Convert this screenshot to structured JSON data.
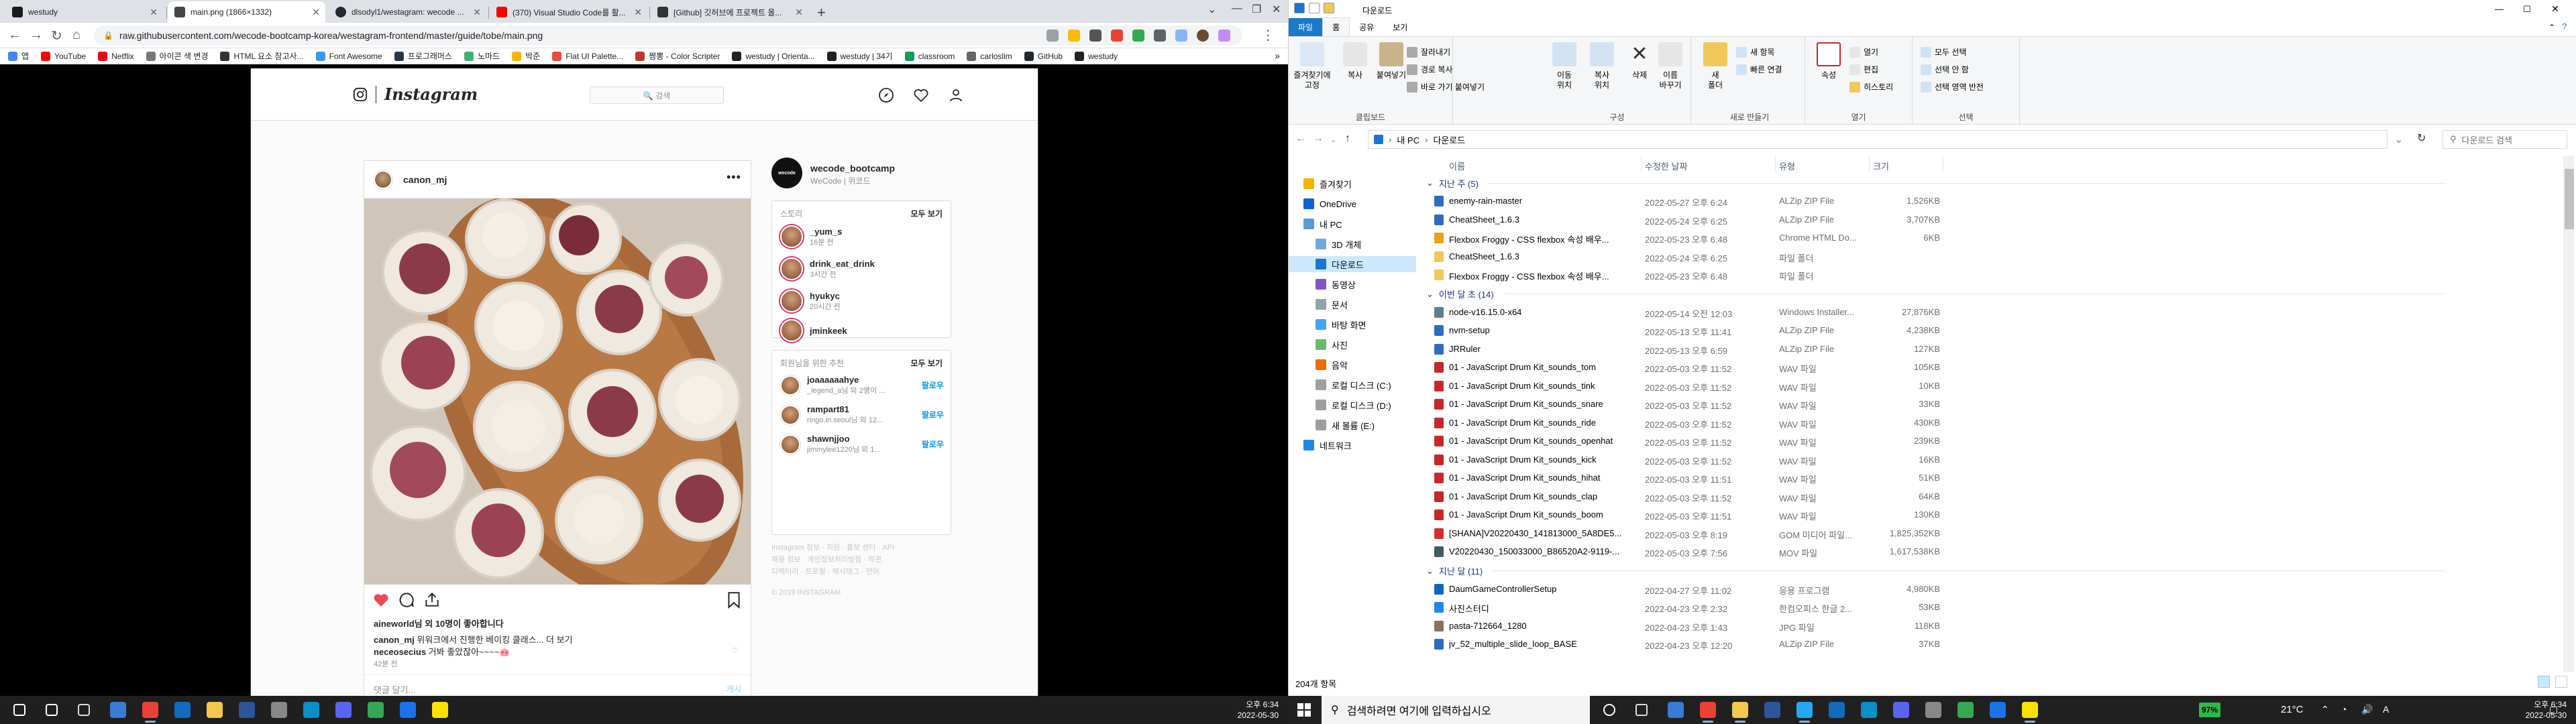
{
  "chrome": {
    "tabs": [
      {
        "title": "westudy",
        "color": "#1a1a1a"
      },
      {
        "title": "main.png (1866×1332)",
        "color": "#444444"
      },
      {
        "title": "dlsodyl1/westagram: wecode ...",
        "color": "#24292e"
      },
      {
        "title": "(370) Visual Studio Code를 활...",
        "color": "#ff0000"
      },
      {
        "title": "[Github] 깃허브에 프로젝트 올...",
        "color": "#333333"
      }
    ],
    "active_tab": 1,
    "url": "raw.githubusercontent.com/wecode-bootcamp-korea/westagram-frontend/master/guide/tobe/main.png",
    "bookmarks": [
      {
        "label": "앱",
        "color": "#4285f4"
      },
      {
        "label": "YouTube",
        "color": "#ff0000"
      },
      {
        "label": "Netflix",
        "color": "#e50914"
      },
      {
        "label": "아이콘 색 변경",
        "color": "#777777"
      },
      {
        "label": "HTML 요소 참고사...",
        "color": "#333333"
      },
      {
        "label": "Font Awesome",
        "color": "#339af0"
      },
      {
        "label": "프로그래머스",
        "color": "#263747"
      },
      {
        "label": "노마드",
        "color": "#3cb371"
      },
      {
        "label": "박준",
        "color": "#ffb400"
      },
      {
        "label": "Flat UI Palette...",
        "color": "#e74c3c"
      },
      {
        "label": "짬뽕 - Color Scripter",
        "color": "#c0392b"
      },
      {
        "label": "westudy | Orienta...",
        "color": "#222222"
      },
      {
        "label": "westudy | 34기",
        "color": "#222222"
      },
      {
        "label": "classroom",
        "color": "#0f9d58"
      },
      {
        "label": "carloslim",
        "color": "#666666"
      },
      {
        "label": "GitHub",
        "color": "#24292e"
      },
      {
        "label": "westudy",
        "color": "#222222"
      }
    ],
    "bookmarks_more": "»"
  },
  "instagram": {
    "logo_word": "Instagram",
    "search_placeholder": "🔍 검색",
    "post": {
      "username": "canon_mj",
      "more": "•••",
      "likes": "aineworld님 외 10명이 좋아합니다",
      "caption_user": "canon_mj",
      "caption_text": "위워크에서 진행한 베이킹 클래스... 더 보기",
      "comment_user": "neceosecius",
      "comment_text": "거봐 좋았잖아~~~~🐽",
      "time_ago": "42분 전",
      "comment_placeholder": "댓글 달기...",
      "comment_post": "게시"
    },
    "side_profile": {
      "name": "wecode_bootcamp",
      "sub": "WeCode | 위코드",
      "avatar_text": "wecode"
    },
    "stories": {
      "header": "스토리",
      "see_all": "모두 보기",
      "items": [
        {
          "name": "_yum_s",
          "sub": "16분 전"
        },
        {
          "name": "drink_eat_drink",
          "sub": "3시간 전"
        },
        {
          "name": "hyukyc",
          "sub": "20시간 전"
        },
        {
          "name": "jminkeek",
          "sub": ""
        }
      ]
    },
    "suggestions": {
      "header": "회원님을 위한 추천",
      "see_all": "모두 보기",
      "items": [
        {
          "name": "joaaaaaahye",
          "sub": "_legend_a님 외 2명이 ...",
          "action": "팔로우"
        },
        {
          "name": "rampart81",
          "sub": "ringo.in.seoul님 외 12...",
          "action": "팔로우"
        },
        {
          "name": "shawnjjoo",
          "sub": "jimmylee1220님 외 1...",
          "action": "팔로우"
        }
      ]
    },
    "footer_lines": [
      "Instagram 정보 · 지원 · 홍보 센터 · API ·",
      "채용 정보 · 개인정보처리방침 · 약관 ·",
      "디렉터리 · 프로필 · 해시태그 · 언어"
    ],
    "copyright": "© 2019 INSTAGRAM"
  },
  "explorer": {
    "title": "다운로드",
    "ribbon_tabs": [
      "파일",
      "홈",
      "공유",
      "보기"
    ],
    "active_ribbon_tab": 1,
    "groups": [
      {
        "name": "클립보드"
      },
      {
        "name": "구성"
      },
      {
        "name": "새로 만들기"
      },
      {
        "name": "열기"
      },
      {
        "name": "선택"
      }
    ],
    "ribbon": {
      "pin": "즐겨찾기에\n고정",
      "copy": "복사",
      "paste": "붙여넣기",
      "cut": "잘라내기",
      "copy_path": "경로 복사",
      "paste_shortcut": "바로 가기 붙여넣기",
      "move_to": "이동\n위치",
      "copy_to": "복사\n위치",
      "delete": "삭제",
      "rename": "이름\n바꾸기",
      "new_folder": "새\n폴더",
      "new_item": "새 항목",
      "easy_access": "빠른 연결",
      "properties": "속성",
      "open": "열기",
      "edit": "편집",
      "history": "히스토리",
      "select_all": "모두 선택",
      "select_none": "선택 안 함",
      "invert": "선택 영역 반전"
    },
    "breadcrumb": [
      "내 PC",
      "다운로드"
    ],
    "search_placeholder": "다운로드 검색",
    "nav": [
      {
        "label": "즐겨찾기",
        "color": "#f4b400",
        "indent": 0
      },
      {
        "label": "OneDrive",
        "color": "#0a64d6",
        "indent": 0
      },
      {
        "label": "내 PC",
        "color": "#5b9bd5",
        "indent": 0
      },
      {
        "label": "3D 개체",
        "color": "#6fa8dc",
        "indent": 1
      },
      {
        "label": "다운로드",
        "color": "#1976d2",
        "indent": 1,
        "selected": true
      },
      {
        "label": "동영상",
        "color": "#7e57c2",
        "indent": 1
      },
      {
        "label": "문서",
        "color": "#90a4ae",
        "indent": 1
      },
      {
        "label": "바탕 화면",
        "color": "#42a5f5",
        "indent": 1
      },
      {
        "label": "사진",
        "color": "#66bb6a",
        "indent": 1
      },
      {
        "label": "음악",
        "color": "#ef6c00",
        "indent": 1
      },
      {
        "label": "로컬 디스크 (C:)",
        "color": "#9e9e9e",
        "indent": 1
      },
      {
        "label": "로컬 디스크 (D:)",
        "color": "#9e9e9e",
        "indent": 1
      },
      {
        "label": "새 볼륨 (E:)",
        "color": "#9e9e9e",
        "indent": 1
      },
      {
        "label": "네트워크",
        "color": "#1e88e5",
        "indent": 0
      }
    ],
    "columns": [
      "이름",
      "수정한 날짜",
      "유형",
      "크기"
    ],
    "groups_list": [
      {
        "title": "지난 주 (5)",
        "files": [
          {
            "name": "enemy-rain-master",
            "date": "2022-05-27 오후 6:24",
            "type": "ALZip ZIP File",
            "size": "1,526KB",
            "color": "#2d6cc0"
          },
          {
            "name": "CheatSheet_1.6.3",
            "date": "2022-05-24 오후 6:25",
            "type": "ALZip ZIP File",
            "size": "3,707KB",
            "color": "#2d6cc0"
          },
          {
            "name": "Flexbox Froggy - CSS flexbox 속성 배우...",
            "date": "2022-05-23 오후 6:48",
            "type": "Chrome HTML Do...",
            "size": "6KB",
            "color": "#e8a317"
          },
          {
            "name": "CheatSheet_1.6.3",
            "date": "2022-05-24 오후 6:25",
            "type": "파일 폴더",
            "size": "",
            "color": "#f0c85a"
          },
          {
            "name": "Flexbox Froggy - CSS flexbox 속성 배우...",
            "date": "2022-05-23 오후 6:48",
            "type": "파일 폴더",
            "size": "",
            "color": "#f0c85a"
          }
        ]
      },
      {
        "title": "이번 달 초 (14)",
        "files": [
          {
            "name": "node-v16.15.0-x64",
            "date": "2022-05-14 오전 12:03",
            "type": "Windows Installer...",
            "size": "27,876KB",
            "color": "#607d8b"
          },
          {
            "name": "nvm-setup",
            "date": "2022-05-13 오후 11:41",
            "type": "ALZip ZIP File",
            "size": "4,238KB",
            "color": "#2d6cc0"
          },
          {
            "name": "JRRuler",
            "date": "2022-05-13 오후 6:59",
            "type": "ALZip ZIP File",
            "size": "127KB",
            "color": "#2d6cc0"
          },
          {
            "name": "01 - JavaScript Drum Kit_sounds_tom",
            "date": "2022-05-03 오후 11:52",
            "type": "WAV 파일",
            "size": "105KB",
            "color": "#c62828"
          },
          {
            "name": "01 - JavaScript Drum Kit_sounds_tink",
            "date": "2022-05-03 오후 11:52",
            "type": "WAV 파일",
            "size": "10KB",
            "color": "#c62828"
          },
          {
            "name": "01 - JavaScript Drum Kit_sounds_snare",
            "date": "2022-05-03 오후 11:52",
            "type": "WAV 파일",
            "size": "33KB",
            "color": "#c62828"
          },
          {
            "name": "01 - JavaScript Drum Kit_sounds_ride",
            "date": "2022-05-03 오후 11:52",
            "type": "WAV 파일",
            "size": "430KB",
            "color": "#c62828"
          },
          {
            "name": "01 - JavaScript Drum Kit_sounds_openhat",
            "date": "2022-05-03 오후 11:52",
            "type": "WAV 파일",
            "size": "239KB",
            "color": "#c62828"
          },
          {
            "name": "01 - JavaScript Drum Kit_sounds_kick",
            "date": "2022-05-03 오후 11:52",
            "type": "WAV 파일",
            "size": "16KB",
            "color": "#c62828"
          },
          {
            "name": "01 - JavaScript Drum Kit_sounds_hihat",
            "date": "2022-05-03 오후 11:51",
            "type": "WAV 파일",
            "size": "51KB",
            "color": "#c62828"
          },
          {
            "name": "01 - JavaScript Drum Kit_sounds_clap",
            "date": "2022-05-03 오후 11:52",
            "type": "WAV 파일",
            "size": "64KB",
            "color": "#c62828"
          },
          {
            "name": "01 - JavaScript Drum Kit_sounds_boom",
            "date": "2022-05-03 오후 11:51",
            "type": "WAV 파일",
            "size": "130KB",
            "color": "#c62828"
          },
          {
            "name": "[SHANA]V20220430_141813000_5A8DE5...",
            "date": "2022-05-03 오후 8:19",
            "type": "GOM 미디어 파일...",
            "size": "1,825,352KB",
            "color": "#d32f2f"
          },
          {
            "name": "V20220430_150033000_B86520A2-9119-...",
            "date": "2022-05-03 오후 7:56",
            "type": "MOV 파일",
            "size": "1,617,538KB",
            "color": "#455a64"
          }
        ]
      },
      {
        "title": "지난 달 (11)",
        "files": [
          {
            "name": "DaumGameControllerSetup",
            "date": "2022-04-27 오후 11:02",
            "type": "응용 프로그램",
            "size": "4,980KB",
            "color": "#1565c0"
          },
          {
            "name": "사진스터디",
            "date": "2022-04-23 오후 2:32",
            "type": "한컴오피스 한글 2...",
            "size": "53KB",
            "color": "#1e88e5"
          },
          {
            "name": "pasta-712664_1280",
            "date": "2022-04-23 오후 1:43",
            "type": "JPG 파일",
            "size": "118KB",
            "color": "#8d6e63"
          },
          {
            "name": "jv_52_multiple_slide_loop_BASE",
            "date": "2022-04-23 오후 12:20",
            "type": "ALZip ZIP File",
            "size": "37KB",
            "color": "#2d6cc0"
          }
        ]
      }
    ],
    "status": "204개 항목"
  },
  "taskbar_left": {
    "time": "오후 6:34",
    "date": "2022-05-30",
    "apps": [
      {
        "name": "start",
        "color": "#ffffff"
      },
      {
        "name": "search",
        "color": "#ffffff"
      },
      {
        "name": "task-view",
        "color": "#dddddd"
      },
      {
        "name": "vscode-mini",
        "color": "#3a7bd5"
      },
      {
        "name": "chrome",
        "color": "#e94235"
      },
      {
        "name": "mail",
        "color": "#0f6cbd"
      },
      {
        "name": "explorer",
        "color": "#f2c94c"
      },
      {
        "name": "word",
        "color": "#2b579a"
      },
      {
        "name": "settings",
        "color": "#888888"
      },
      {
        "name": "edge",
        "color": "#0c8ec7"
      },
      {
        "name": "discord",
        "color": "#5865f2"
      },
      {
        "name": "chrome2",
        "color": "#34a853"
      },
      {
        "name": "maps",
        "color": "#1a73e8"
      },
      {
        "name": "kakao",
        "color": "#fae100"
      }
    ]
  },
  "taskbar_right": {
    "search_placeholder": "검색하려면 여기에 입력하십시오",
    "battery": "97%",
    "weather": "21°C",
    "time": "오후 6:34",
    "date": "2022-05-30",
    "apps": [
      {
        "name": "cortana",
        "color": "#ffffff"
      },
      {
        "name": "task-view",
        "color": "#dddddd"
      },
      {
        "name": "files-mini",
        "color": "#3a7bd5"
      },
      {
        "name": "chrome",
        "color": "#e94235"
      },
      {
        "name": "explorer",
        "color": "#f2c94c"
      },
      {
        "name": "word",
        "color": "#2b579a"
      },
      {
        "name": "vscode",
        "color": "#23a9f2"
      },
      {
        "name": "mail",
        "color": "#0f6cbd"
      },
      {
        "name": "edge",
        "color": "#0c8ec7"
      },
      {
        "name": "discord",
        "color": "#5865f2"
      },
      {
        "name": "settings",
        "color": "#888888"
      },
      {
        "name": "chrome2",
        "color": "#34a853"
      },
      {
        "name": "maps",
        "color": "#1a73e8"
      },
      {
        "name": "kakao",
        "color": "#fae100"
      }
    ]
  }
}
